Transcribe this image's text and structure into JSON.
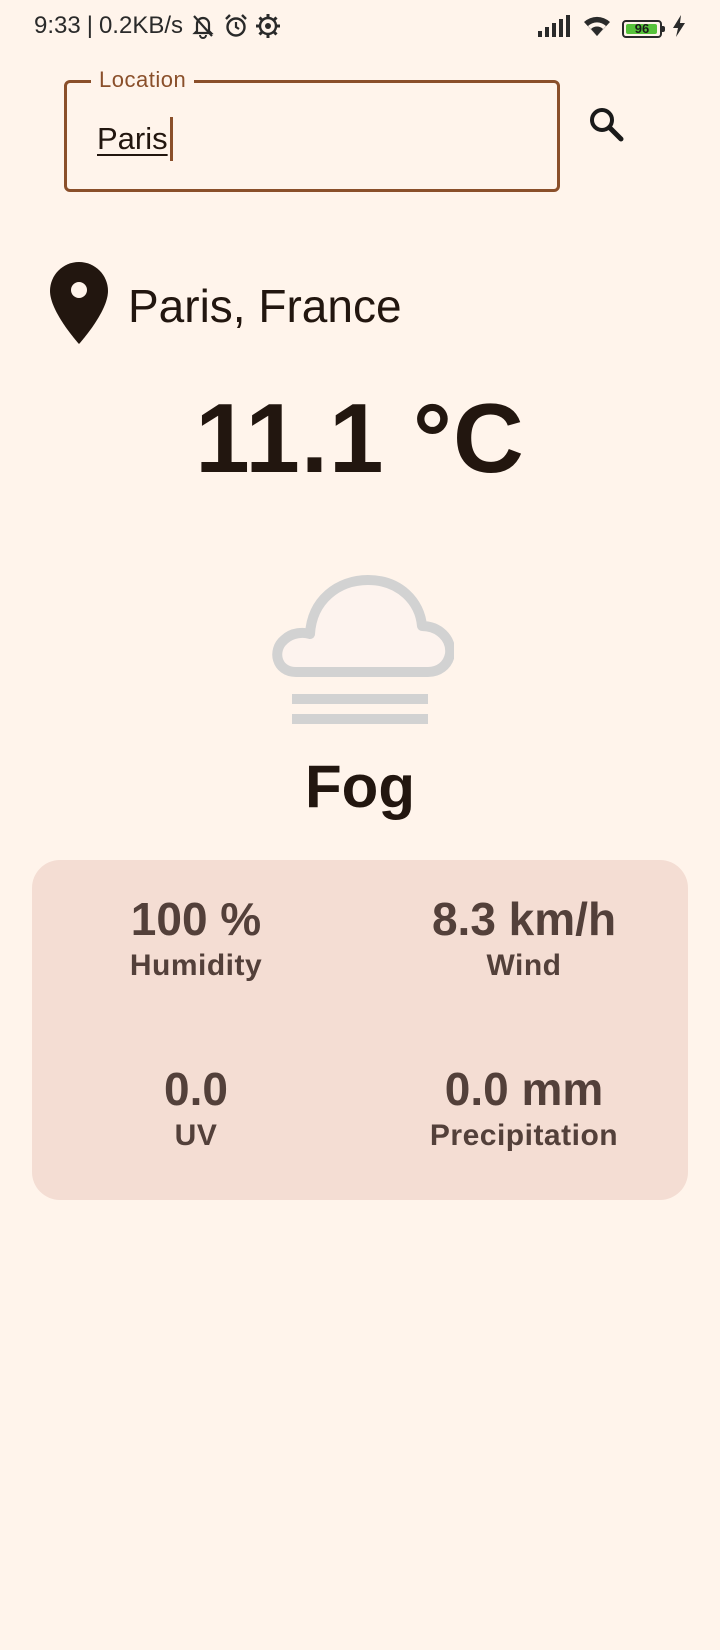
{
  "status_bar": {
    "time": "9:33",
    "separator": "|",
    "network_speed": "0.2KB/s",
    "icons_left": [
      "mute-bell-icon",
      "alarm-icon",
      "settings-gear-icon"
    ],
    "icons_right": [
      "signal-icon",
      "wifi-icon",
      "battery-icon",
      "charging-icon"
    ],
    "battery_level": "96",
    "battery_fraction": 0.96
  },
  "search": {
    "label": "Location",
    "value": "Paris",
    "button_icon": "search-icon"
  },
  "location": {
    "icon": "location-pin-icon",
    "name": "Paris, France"
  },
  "weather": {
    "temperature": "11.1 °C",
    "condition": "Fog",
    "condition_icon": "fog-cloud-icon"
  },
  "details": {
    "humidity": {
      "value": "100 %",
      "label": "Humidity"
    },
    "wind": {
      "value": "8.3 km/h",
      "label": "Wind"
    },
    "uv": {
      "value": "0.0",
      "label": "UV"
    },
    "precipitation": {
      "value": "0.0 mm",
      "label": "Precipitation"
    }
  },
  "colors": {
    "background": "#fff4eb",
    "accent": "#8a4f2a",
    "card": "#f4ddd3",
    "text": "#22160f",
    "muted_text": "#53403a",
    "fog_icon": "#d2d2d2"
  }
}
